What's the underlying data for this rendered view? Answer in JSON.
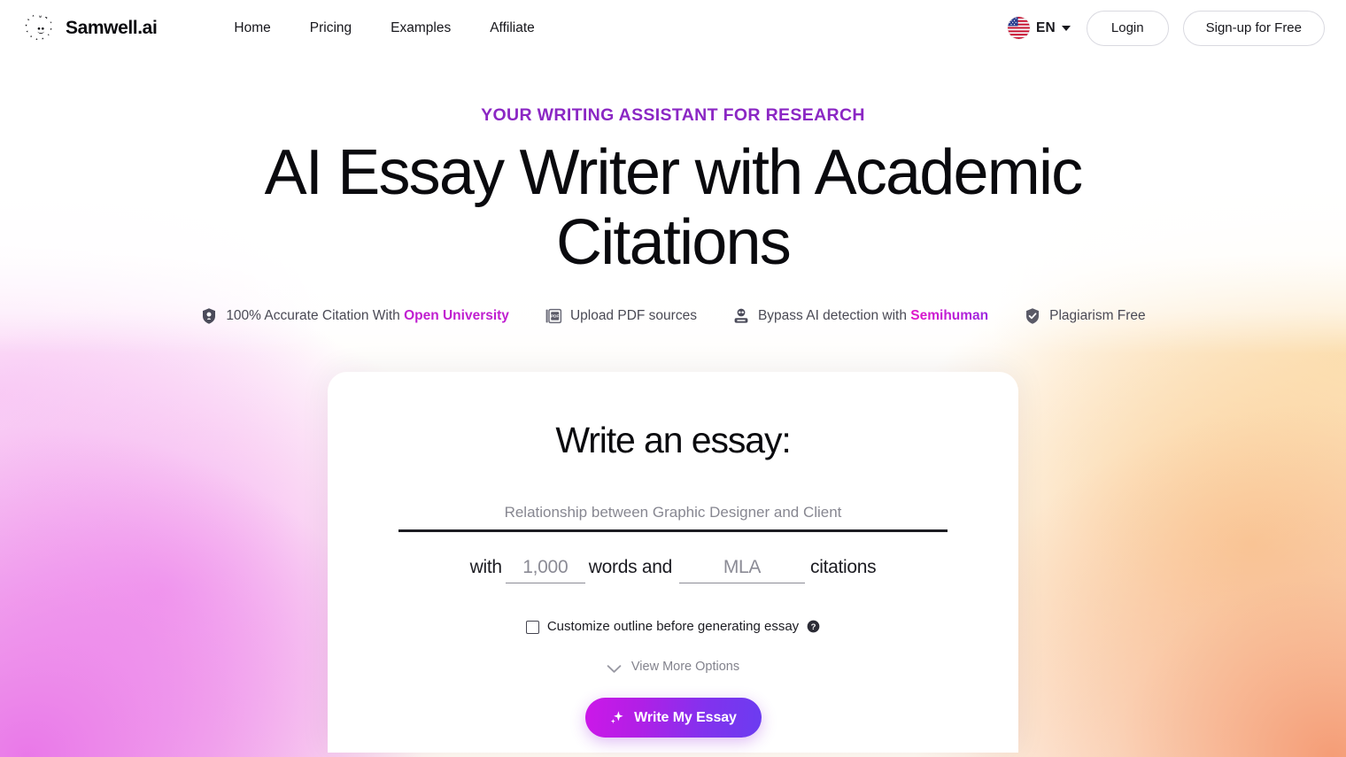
{
  "header": {
    "brand": {
      "name": "Samwell.ai",
      "logo_icon": "samwell-sun-face-logo"
    },
    "nav": [
      {
        "label": "Home",
        "name": "nav-link-home"
      },
      {
        "label": "Pricing",
        "name": "nav-link-pricing"
      },
      {
        "label": "Examples",
        "name": "nav-link-examples"
      },
      {
        "label": "Affiliate",
        "name": "nav-link-affiliate"
      }
    ],
    "language": {
      "code": "EN",
      "flag_icon": "us-flag-icon",
      "caret_icon": "chevron-down-icon"
    },
    "login_label": "Login",
    "signup_label": "Sign-up for Free"
  },
  "hero": {
    "eyebrow": "YOUR WRITING ASSISTANT FOR RESEARCH",
    "eyebrow_color": "#8b27c4",
    "headline": "AI Essay Writer with Academic Citations",
    "badges": [
      {
        "icon": "shield-dot-icon",
        "text_before": "100% Accurate Citation With ",
        "highlight": "Open University",
        "text_after": "",
        "highlight_style": "solid"
      },
      {
        "icon": "pdf-file-icon",
        "text_before": "Upload PDF sources",
        "highlight": "",
        "text_after": "",
        "highlight_style": "none"
      },
      {
        "icon": "robot-icon",
        "text_before": "Bypass AI detection with ",
        "highlight": "Semihuman",
        "text_after": "",
        "highlight_style": "gradient"
      },
      {
        "icon": "shield-check-icon",
        "text_before": "Plagiarism Free",
        "highlight": "",
        "text_after": "",
        "highlight_style": "none"
      }
    ]
  },
  "form": {
    "title": "Write an essay:",
    "topic_placeholder": "Relationship between Graphic Designer and Client",
    "topic_value": "",
    "with_label": "with",
    "words_placeholder": "1,000",
    "words_value": "",
    "words_label": "words and",
    "style_placeholder": "MLA",
    "style_value": "",
    "citations_label": "citations",
    "outline_label": "Customize outline before generating essay",
    "outline_checked": false,
    "help_icon": "question-mark-circle-icon",
    "more_options_label": "View More Options",
    "more_options_icon": "chevron-down-icon",
    "submit_label": "Write My Essay",
    "submit_icon": "sparkle-icon"
  },
  "theme": {
    "accent_magenta": "#cc18e8",
    "accent_purple": "#6b3cf0",
    "badge_highlight": "#c01fd0",
    "bg_left": "#e872e8",
    "bg_right": "#f4966e",
    "bg_center": "#ffffff"
  }
}
